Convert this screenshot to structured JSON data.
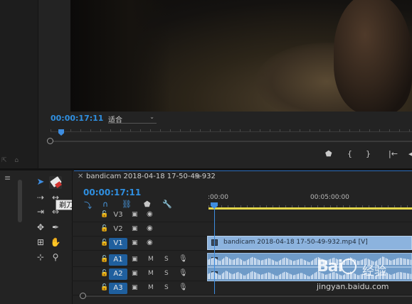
{
  "program_monitor": {
    "timecode": "00:00:17:11",
    "fit_dropdown": {
      "selected": "适合"
    },
    "transport_icons": [
      "marker-icon",
      "mark-in-icon",
      "mark-out-icon",
      "go-to-in-icon"
    ]
  },
  "tools": {
    "items": [
      "selection-tool",
      "razor-tool",
      "track-select-tool",
      "ripple-edit-tool",
      "rolling-edit-tool",
      "slip-tool",
      "pen-tool",
      "rate-stretch-tool",
      "hand-tool",
      "type-tool",
      "zoom-tool"
    ],
    "razor_tooltip": "剃刀工具"
  },
  "timeline": {
    "sequence_name": "bandicam 2018-04-18 17-50-49-932",
    "timecode": "00:00:17:11",
    "ruler_labels": [
      ":00:00",
      "00:05:00:00"
    ],
    "tracks": [
      {
        "name": "V3",
        "kind": "video",
        "targeted": false
      },
      {
        "name": "V2",
        "kind": "video",
        "targeted": false
      },
      {
        "name": "V1",
        "kind": "video",
        "targeted": true
      },
      {
        "name": "A1",
        "kind": "audio",
        "targeted": true,
        "mute": "M",
        "solo": "S"
      },
      {
        "name": "A2",
        "kind": "audio",
        "targeted": true,
        "mute": "M",
        "solo": "S"
      },
      {
        "name": "A3",
        "kind": "audio",
        "targeted": true,
        "mute": "M",
        "solo": "S"
      }
    ],
    "clip_v1_label": "bandicam 2018-04-18 17-50-49-932.mp4 [V]",
    "accent_color": "#2f8fe0"
  },
  "watermark": {
    "logo": "Bai",
    "logo_tail": "经验",
    "url": "jingyan.baidu.com"
  }
}
